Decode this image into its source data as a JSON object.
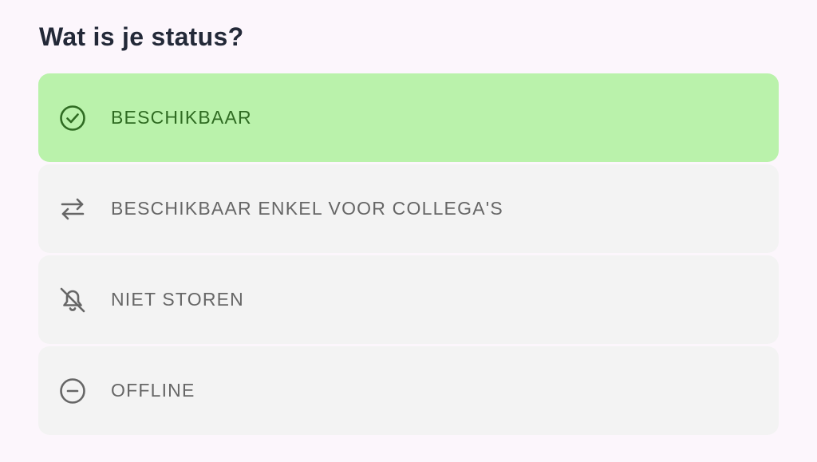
{
  "heading": "Wat is je status?",
  "options": [
    {
      "label": "BESCHIKBAAR",
      "icon": "check-circle-icon",
      "selected": true
    },
    {
      "label": "BESCHIKBAAR ENKEL VOOR COLLEGA'S",
      "icon": "swap-arrows-icon",
      "selected": false
    },
    {
      "label": "NIET STOREN",
      "icon": "bell-off-icon",
      "selected": false
    },
    {
      "label": "OFFLINE",
      "icon": "minus-circle-icon",
      "selected": false
    }
  ],
  "colors": {
    "background": "#fcf6fc",
    "selected_background": "#baf2ab",
    "selected_text": "#2f6b22",
    "option_background": "#f3f3f3",
    "option_text": "#666666",
    "heading_text": "#232938"
  }
}
